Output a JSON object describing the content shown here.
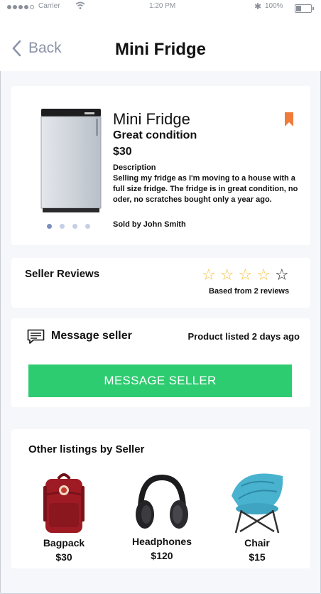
{
  "status_bar": {
    "carrier": "Carrier",
    "time": "1:20 PM",
    "battery": "100%"
  },
  "nav": {
    "back_label": "Back",
    "title": "Mini Fridge"
  },
  "product": {
    "title": "Mini Fridge",
    "condition": "Great condition",
    "price": "$30",
    "description_label": "Description",
    "description": "Selling my fridge as I'm moving to a house with a full size fridge. The fridge is in great condition, no oder, no scratches bought only a year ago.",
    "sold_by": "Sold by John Smith",
    "image_count": 4,
    "active_image": 1
  },
  "reviews": {
    "title": "Seller Reviews",
    "rating": 0,
    "max_rating": 5,
    "count_text": "Based from 2 reviews"
  },
  "message": {
    "label": "Message seller",
    "listed": "Product listed 2 days ago",
    "button": "MESSAGE SELLER"
  },
  "other_listings": {
    "title": "Other listings by Seller",
    "items": [
      {
        "name": "Bagpack",
        "price": "$30"
      },
      {
        "name": "Headphones",
        "price": "$120"
      },
      {
        "name": "Chair",
        "price": "$15"
      }
    ]
  },
  "colors": {
    "accent_green": "#2ecc71",
    "bookmark": "#ef7c3a",
    "back": "#8b93a7",
    "star": "#f5c242"
  }
}
